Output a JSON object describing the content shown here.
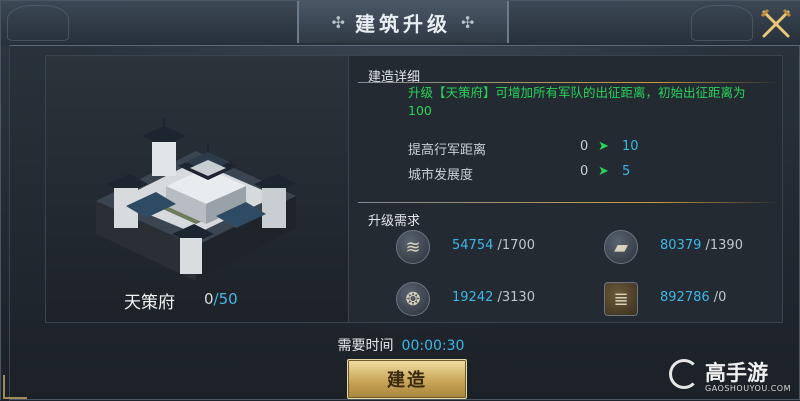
{
  "header": {
    "title": "建筑升级"
  },
  "building": {
    "name": "天策府",
    "level_current": "0",
    "level_max": "/50"
  },
  "details": {
    "section_title": "建造详细",
    "description": "升级【天策府】可增加所有军队的出征距离，初始出征距离为100",
    "stats": [
      {
        "label": "提高行军距离",
        "from": "0",
        "to": "10"
      },
      {
        "label": "城市发展度",
        "from": "0",
        "to": "5"
      }
    ]
  },
  "requirements": {
    "section_title": "升级需求",
    "resources": [
      {
        "icon": "wood-log-icon",
        "have": "54754",
        "need": "/1700"
      },
      {
        "icon": "iron-ingot-icon",
        "have": "80379",
        "need": "/1390"
      },
      {
        "icon": "grain-sack-icon",
        "have": "19242",
        "need": "/3130"
      },
      {
        "icon": "scroll-icon",
        "have": "892786",
        "need": "/0"
      }
    ]
  },
  "footer": {
    "time_label": "需要时间",
    "time_value": "00:00:30",
    "build_button": "建造"
  },
  "watermark": {
    "name": "高手游",
    "domain": "GAOSHOUYOU.COM"
  },
  "colors": {
    "green_text": "#29d35a",
    "blue_value": "#3eb6e8",
    "gold_button": "#c9a658"
  }
}
